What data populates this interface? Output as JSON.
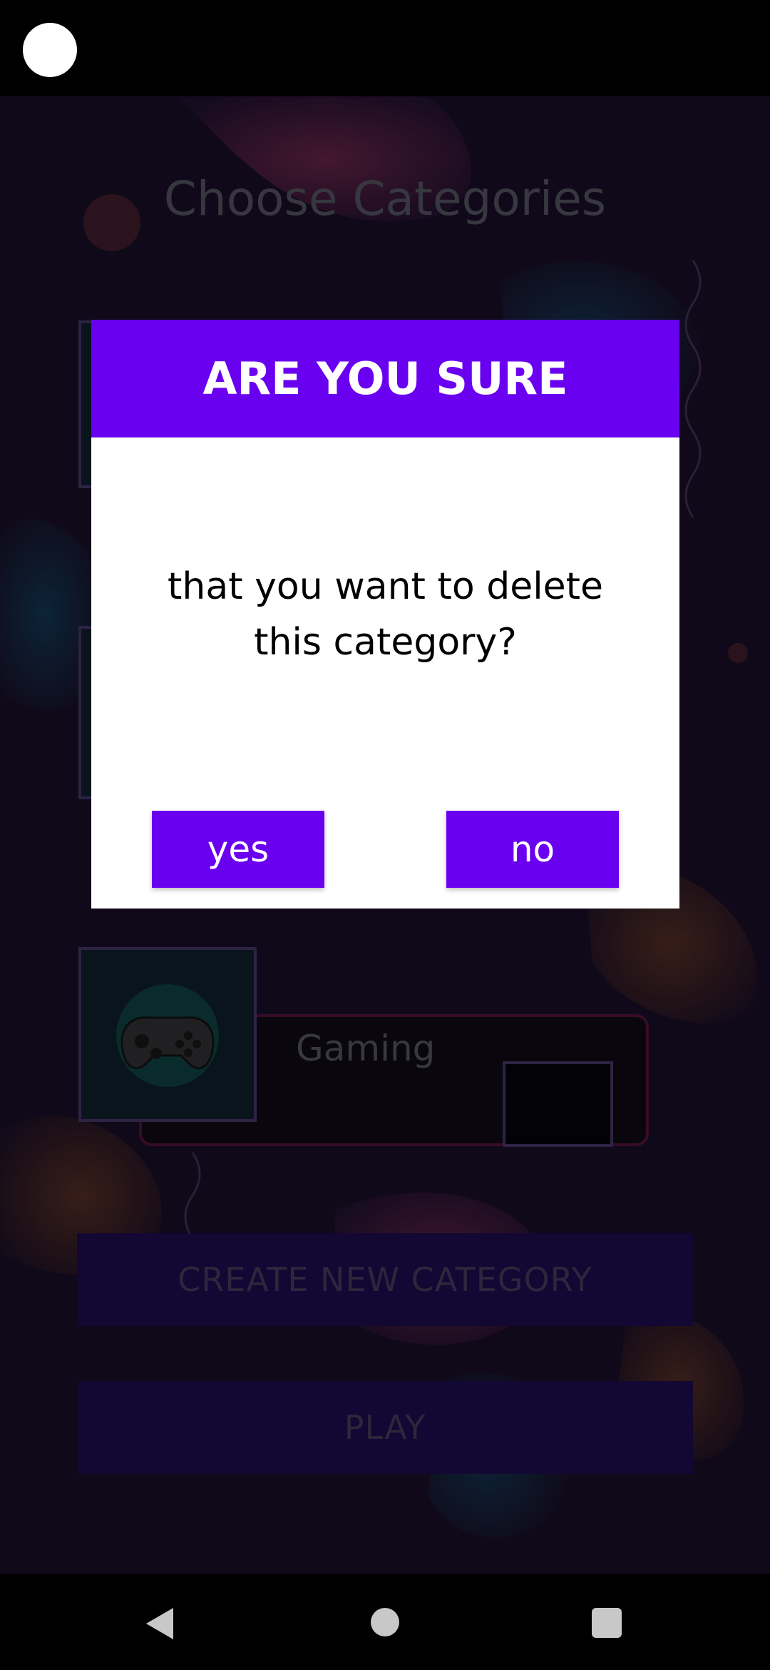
{
  "screen": {
    "title": "Choose Categories"
  },
  "categories": [
    {
      "name": ""
    },
    {
      "name": ""
    },
    {
      "name": "Gaming",
      "icon": "gamepad-icon"
    }
  ],
  "buttons": {
    "create_label": "CREATE NEW CATEGORY",
    "play_label": "PLAY"
  },
  "dialog": {
    "title": "ARE YOU SURE",
    "message_line1": "that you want to delete",
    "message_line2": "this category?",
    "yes_label": "yes",
    "no_label": "no"
  },
  "colors": {
    "accent": "#6a00f0",
    "dialog_bg": "#ffffff",
    "screen_bg": "#150d22"
  },
  "nav": {
    "back_icon": "back-triangle-icon",
    "home_icon": "home-circle-icon",
    "recent_icon": "recents-square-icon"
  }
}
